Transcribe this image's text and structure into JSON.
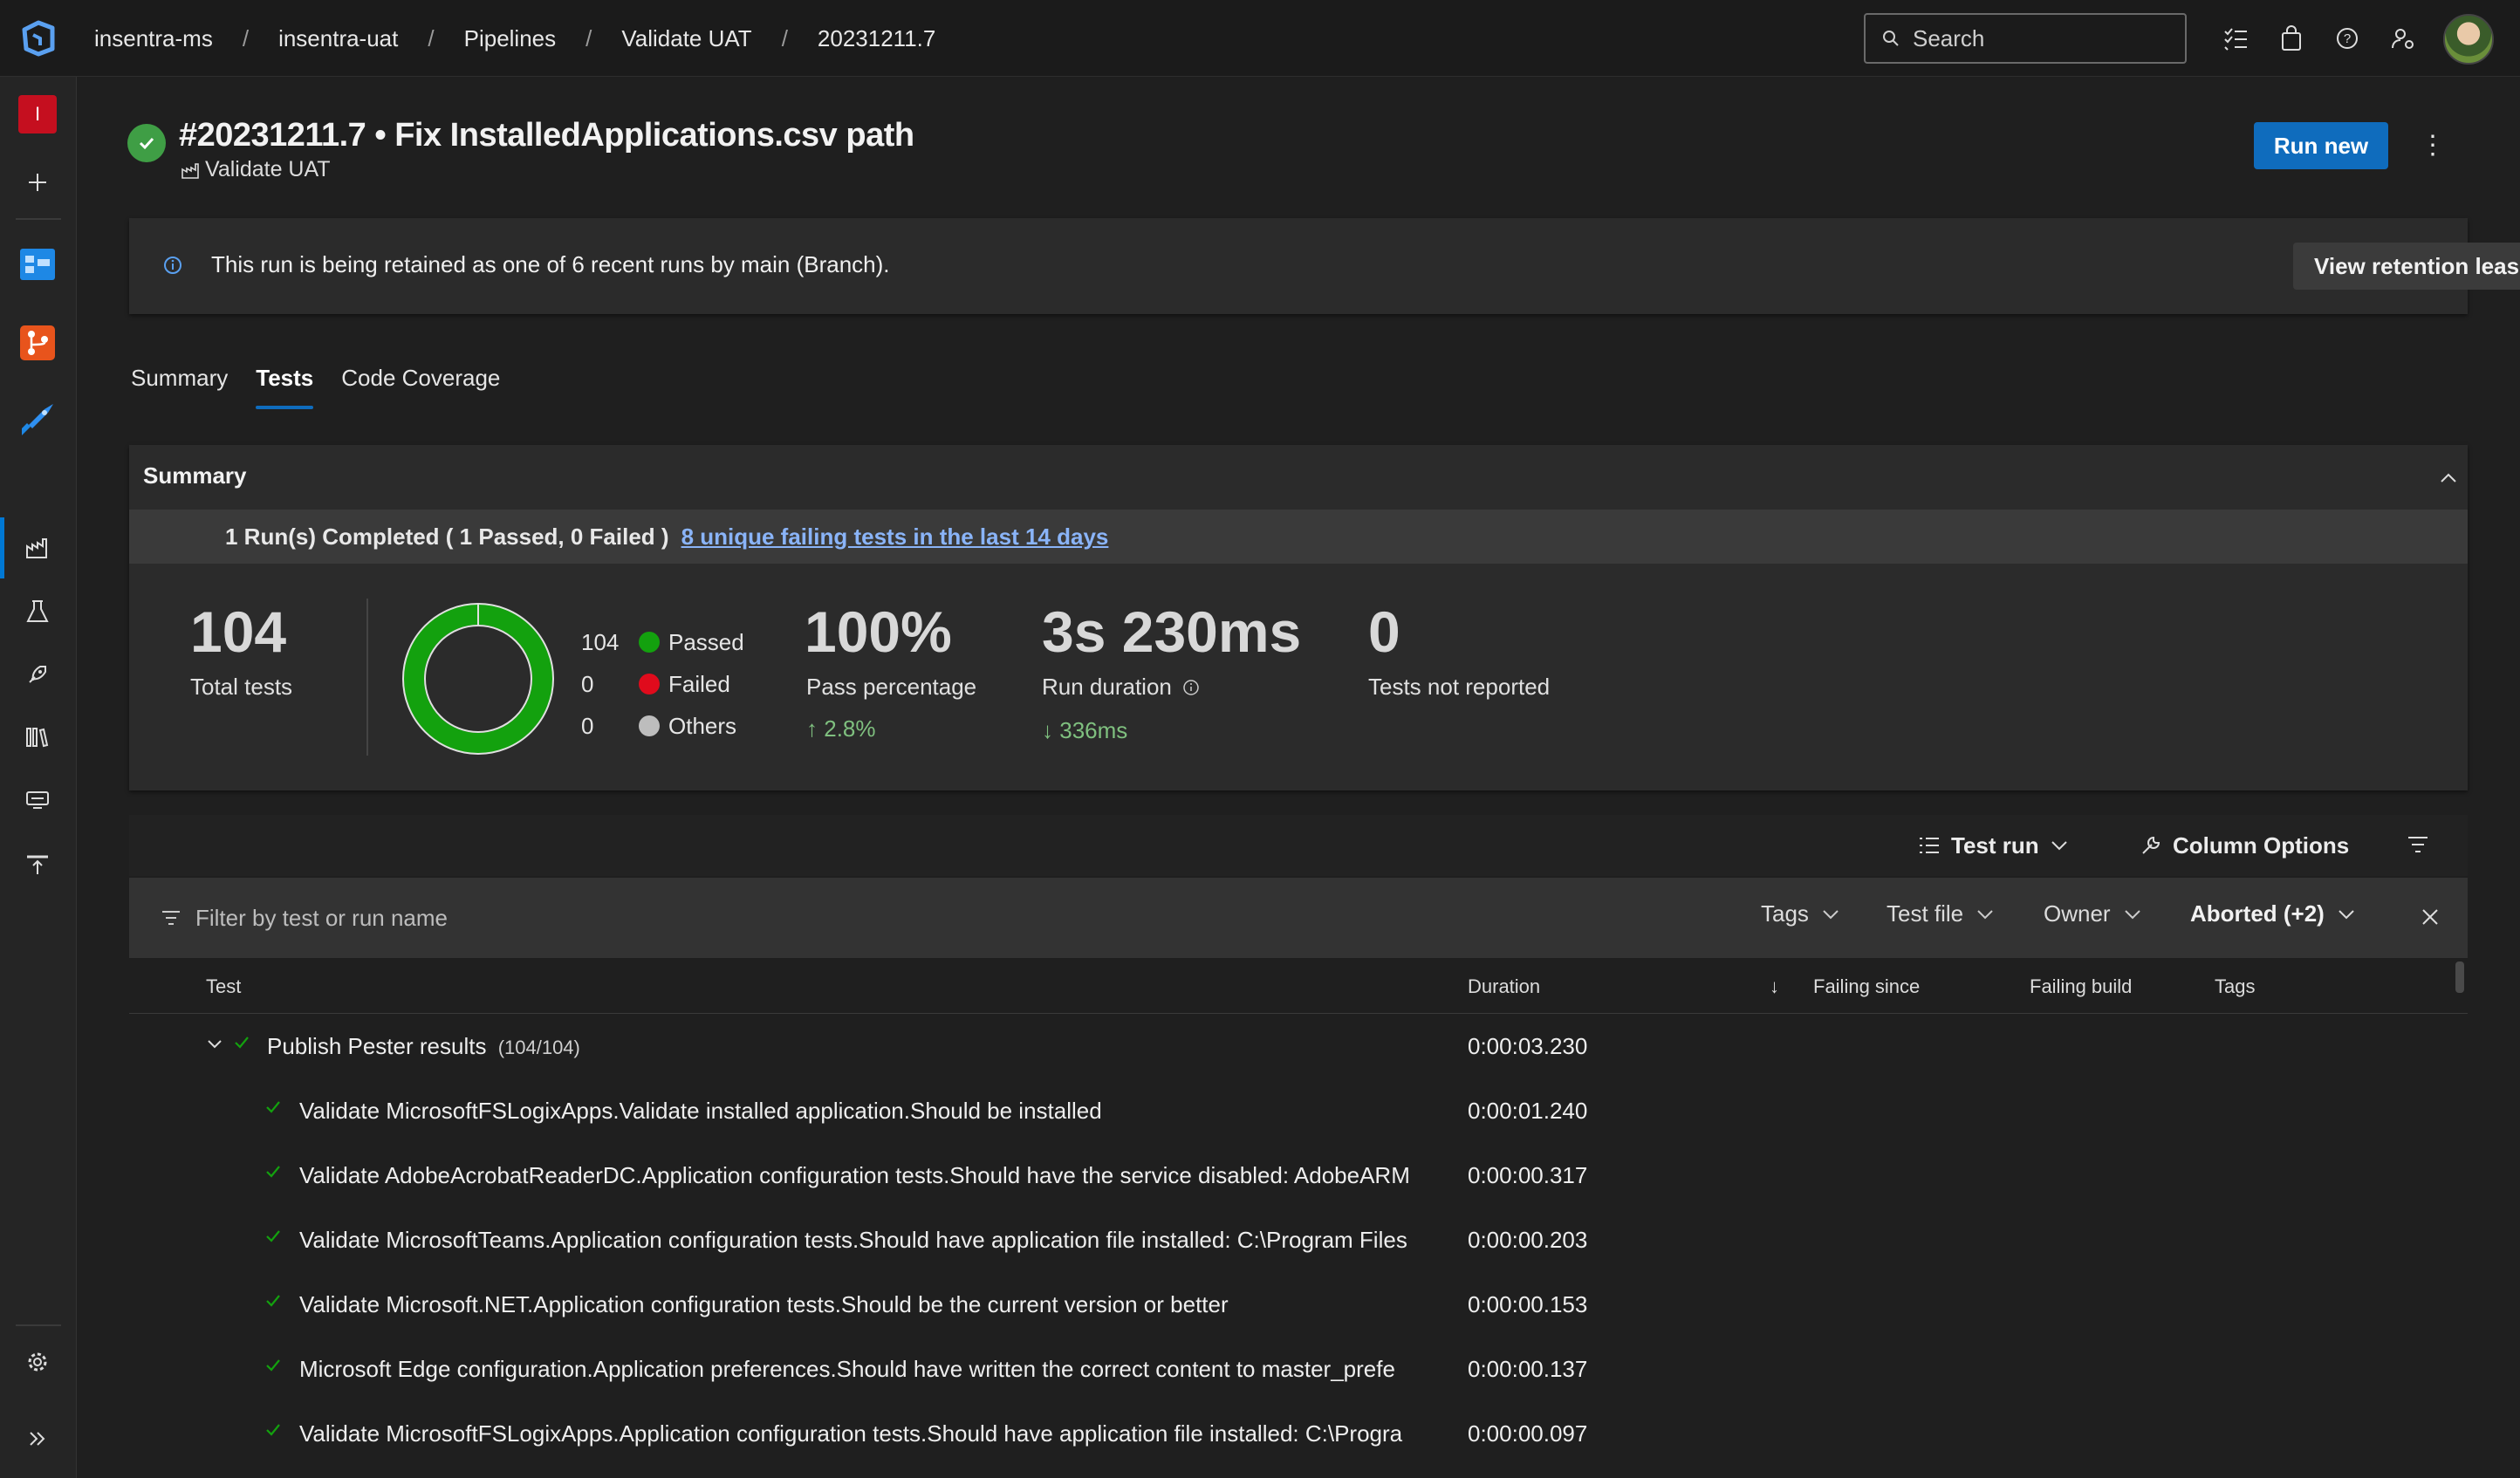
{
  "breadcrumbs": [
    "insentra-ms",
    "insentra-uat",
    "Pipelines",
    "Validate UAT",
    "20231211.7"
  ],
  "search": {
    "placeholder": "Search"
  },
  "org_badge": "I",
  "header": {
    "title": "#20231211.7 • Fix InstalledApplications.csv path",
    "pipeline": "Validate UAT",
    "run_new_label": "Run new"
  },
  "banner": {
    "message": "This run is being retained as one of 6 recent runs by main (Branch).",
    "button_label": "View retention leases"
  },
  "tabs": [
    {
      "label": "Summary",
      "active": false
    },
    {
      "label": "Tests",
      "active": true
    },
    {
      "label": "Code Coverage",
      "active": false
    }
  ],
  "summary": {
    "heading": "Summary",
    "runs_text": "1 Run(s) Completed ( 1 Passed, 0 Failed )",
    "failing_link": "8 unique failing tests in the last 14 days",
    "total_tests": "104",
    "total_tests_label": "Total tests",
    "legend": [
      {
        "count": "104",
        "label": "Passed",
        "color": "#13a10e"
      },
      {
        "count": "0",
        "label": "Failed",
        "color": "#e00b1c"
      },
      {
        "count": "0",
        "label": "Others",
        "color": "#bdbdbd"
      }
    ],
    "pass_pct": "100%",
    "pass_pct_label": "Pass percentage",
    "pass_delta": "2.8%",
    "duration": "3s 230ms",
    "duration_label": "Run duration",
    "duration_delta": "336ms",
    "not_reported": "0",
    "not_reported_label": "Tests not reported"
  },
  "toolbar": {
    "test_run_label": "Test run",
    "column_options_label": "Column Options"
  },
  "filter": {
    "placeholder": "Filter by test or run name",
    "dropdowns": [
      "Tags",
      "Test file",
      "Owner",
      "Aborted (+2)"
    ]
  },
  "table": {
    "columns": [
      "Test",
      "Duration",
      "Failing since",
      "Failing build",
      "Tags"
    ],
    "group": {
      "name": "Publish Pester results",
      "count": "(104/104)",
      "duration": "0:00:03.230"
    },
    "rows": [
      {
        "name": "Validate MicrosoftFSLogixApps.Validate installed application.Should be installed",
        "duration": "0:00:01.240"
      },
      {
        "name": "Validate AdobeAcrobatReaderDC.Application configuration tests.Should have the service disabled: AdobeARM",
        "duration": "0:00:00.317"
      },
      {
        "name": "Validate MicrosoftTeams.Application configuration tests.Should have application file installed: C:\\Program Files",
        "duration": "0:00:00.203"
      },
      {
        "name": "Validate Microsoft.NET.Application configuration tests.Should be the current version or better",
        "duration": "0:00:00.153"
      },
      {
        "name": "Microsoft Edge configuration.Application preferences.Should have written the correct content to master_prefe",
        "duration": "0:00:00.137"
      },
      {
        "name": "Validate MicrosoftFSLogixApps.Application configuration tests.Should have application file installed: C:\\Progra",
        "duration": "0:00:00.097"
      }
    ]
  }
}
